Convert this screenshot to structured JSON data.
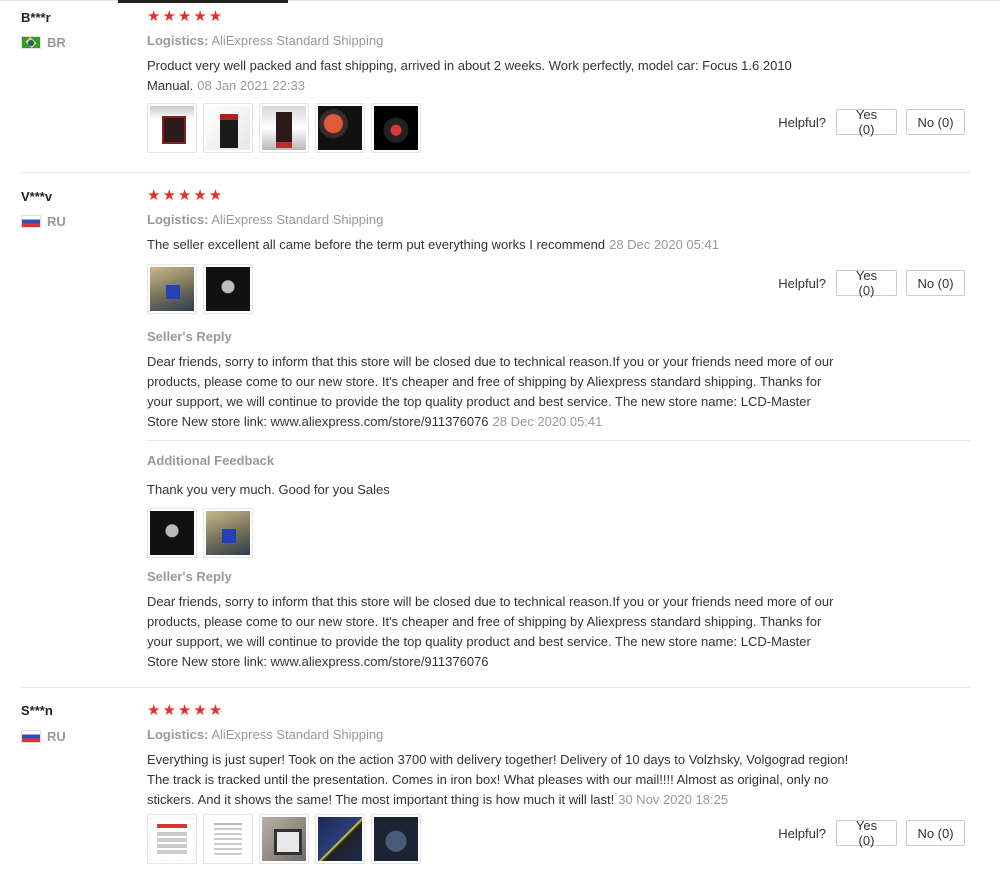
{
  "helpful_label": "Helpful?",
  "reviews": [
    {
      "user": "B***r",
      "country": "BR",
      "stars": "★★★★★",
      "logistics_label": "Logistics:",
      "logistics_value": "AliExpress Standard Shipping",
      "text": "Product very well packed and fast shipping, arrived in about 2 weeks. Work perfectly, model car: Focus 1.6 2010 Manual.",
      "date": "08 Jan 2021 22:33",
      "yes_label": "Yes (0)",
      "no_label": "No (0)"
    },
    {
      "user": "V***v",
      "country": "RU",
      "stars": "★★★★★",
      "logistics_label": "Logistics:",
      "logistics_value": "AliExpress Standard Shipping",
      "text": "The seller excellent all came before the term put everything works I recommend",
      "date": "28 Dec 2020 05:41",
      "yes_label": "Yes (0)",
      "no_label": "No (0)",
      "seller_reply_title": "Seller's Reply",
      "seller_reply_text": "Dear friends, sorry to inform that this store will be closed due to technical reason.If you or your friends need more of our products, please come to our new store. It's cheaper and free of shipping by Aliexpress standard shipping. Thanks for your support, we will continue to provide the top quality product and best service. The new store name: LCD-Master Store New store link: www.aliexpress.com/store/911376076",
      "seller_reply_date": "28 Dec 2020 05:41",
      "additional_title": "Additional Feedback",
      "additional_text": "Thank you very much. Good for you Sales",
      "seller_reply2_title": "Seller's Reply",
      "seller_reply2_text": "Dear friends, sorry to inform that this store will be closed due to technical reason.If you or your friends need more of our products, please come to our new store. It's cheaper and free of shipping by Aliexpress standard shipping. Thanks for your support, we will continue to provide the top quality product and best service. The new store name: LCD-Master Store New store link: www.aliexpress.com/store/911376076"
    },
    {
      "user": "S***n",
      "country": "RU",
      "stars": "★★★★★",
      "logistics_label": "Logistics:",
      "logistics_value": "AliExpress Standard Shipping",
      "text": "Everything is just super! Took on the action 3700 with delivery together! Delivery of 10 days to Volzhsky, Volgograd region! The track is tracked until the presentation. Comes in iron box! What pleases with our mail!!!! Almost as original, only no stickers. And it shows the same! The most important thing is how much it will last!",
      "date": "30 Nov 2020 18:25",
      "yes_label": "Yes (0)",
      "no_label": "No (0)"
    }
  ]
}
